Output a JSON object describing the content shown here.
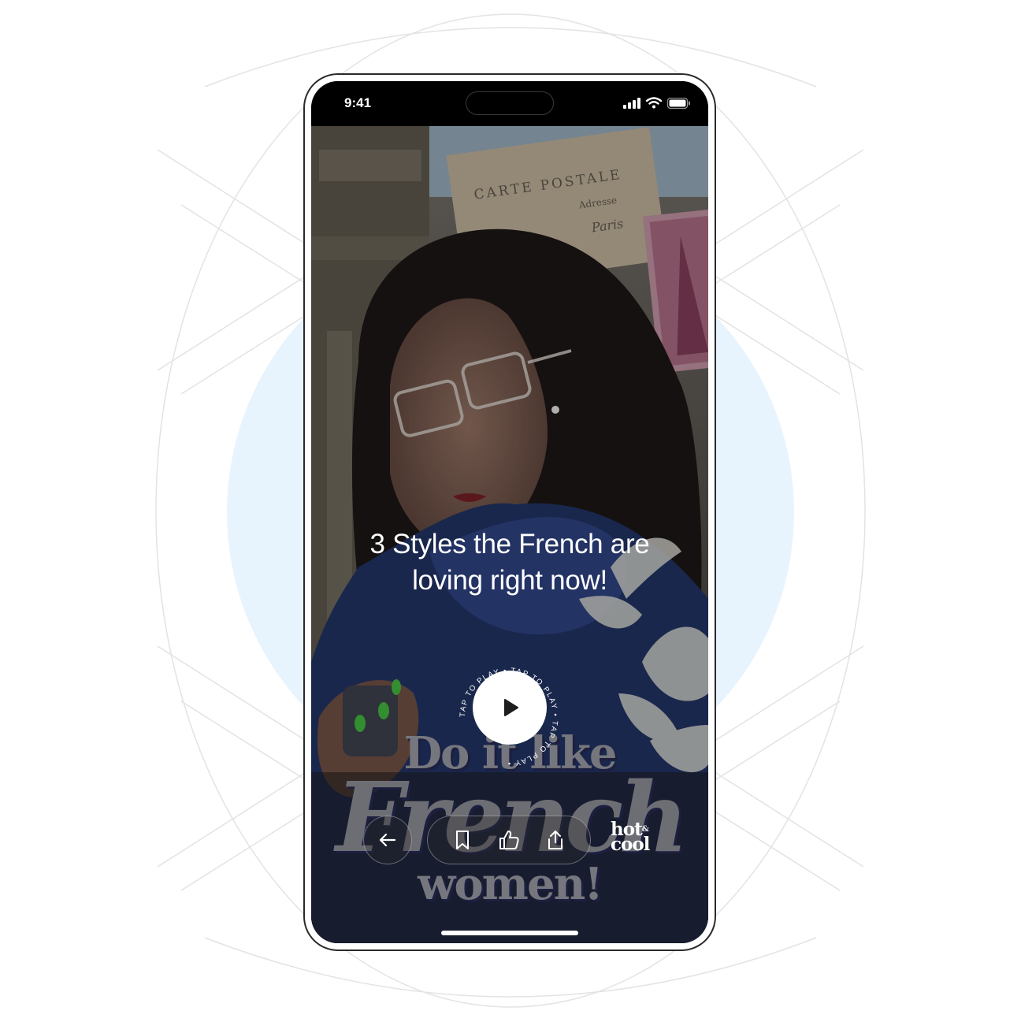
{
  "status_bar": {
    "time": "9:41"
  },
  "video": {
    "headline_line1": "3 Styles the French are",
    "headline_line2": "loving right now!",
    "title_line1": "Do it like",
    "title_line2": "French",
    "title_line3": "women!",
    "play_ring_text": "TAP TO PLAY • TAP TO PLAY • TAP TO PLAY • "
  },
  "postcard": {
    "line1": "CARTE POSTALE",
    "line2": "Adresse",
    "line3": "Paris"
  },
  "brand": {
    "line1": "hot",
    "amp": "&",
    "line2": "cool"
  },
  "icons": {
    "back": "arrow-left-icon",
    "bookmark": "bookmark-icon",
    "like": "thumbs-up-icon",
    "share": "share-icon",
    "play": "play-icon"
  },
  "colors": {
    "accent_bg": "#e8f4fd",
    "overlay_text": "#76777e",
    "shadow": "#1c1f3f"
  }
}
